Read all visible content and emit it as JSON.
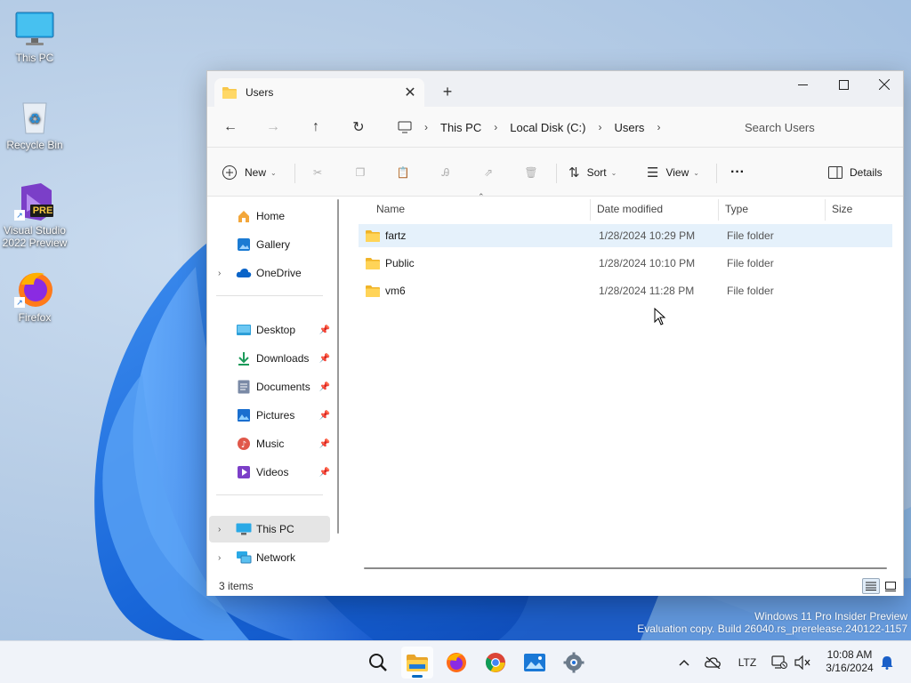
{
  "desktop": {
    "icons": [
      {
        "label": "This PC"
      },
      {
        "label": "Recycle Bin"
      },
      {
        "label": "Visual Studio 2022 Preview",
        "badge": "PRE"
      },
      {
        "label": "Firefox"
      }
    ]
  },
  "window": {
    "tab_title": "Users",
    "breadcrumb": [
      "This PC",
      "Local Disk (C:)",
      "Users"
    ],
    "search_placeholder": "Search Users",
    "toolbar": {
      "new_label": "New",
      "sort_label": "Sort",
      "view_label": "View",
      "more_label": "···",
      "details_label": "Details"
    },
    "nav": {
      "top": [
        {
          "label": "Home"
        },
        {
          "label": "Gallery"
        },
        {
          "label": "OneDrive"
        }
      ],
      "quick": [
        {
          "label": "Desktop"
        },
        {
          "label": "Downloads"
        },
        {
          "label": "Documents"
        },
        {
          "label": "Pictures"
        },
        {
          "label": "Music"
        },
        {
          "label": "Videos"
        }
      ],
      "bottom": [
        {
          "label": "This PC"
        },
        {
          "label": "Network"
        }
      ]
    },
    "columns": [
      "Name",
      "Date modified",
      "Type",
      "Size"
    ],
    "rows": [
      {
        "name": "fartz",
        "date": "1/28/2024 10:29 PM",
        "type": "File folder",
        "size": ""
      },
      {
        "name": "Public",
        "date": "1/28/2024 10:10 PM",
        "type": "File folder",
        "size": ""
      },
      {
        "name": "vm6",
        "date": "1/28/2024 11:28 PM",
        "type": "File folder",
        "size": ""
      }
    ],
    "status": "3 items"
  },
  "watermark": {
    "line1": "Windows 11 Pro Insider Preview",
    "line2": "Evaluation copy. Build 26040.rs_prerelease.240122-1157"
  },
  "taskbar": {
    "apps": [
      "search-icon",
      "file-explorer-icon",
      "firefox-icon",
      "chrome-icon",
      "photos-icon",
      "settings-icon"
    ],
    "tray_lang": "LTZ",
    "time": "10:08 AM",
    "date": "3/16/2024"
  },
  "colors": {
    "accent": "#0067c0",
    "folder": "#f8c74a",
    "row_hover": "#e5f1fb",
    "taskbar": "#f0f3f9"
  }
}
